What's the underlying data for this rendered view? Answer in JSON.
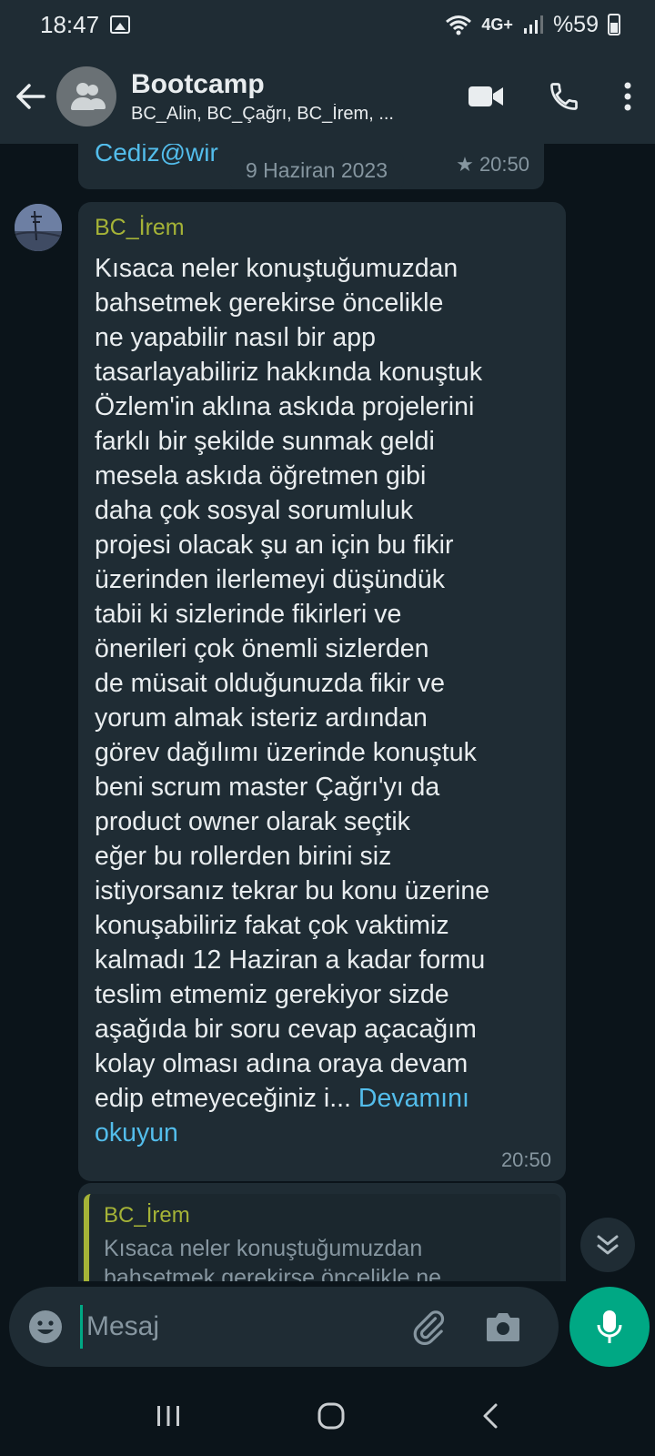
{
  "status_bar": {
    "time": "18:47",
    "network": "4G+",
    "battery": "%59"
  },
  "header": {
    "group_name": "Bootcamp",
    "members": "BC_Alin, BC_Çağrı, BC_İrem, ..."
  },
  "chat": {
    "previous_message": {
      "text_fragment": "Cediz@wir",
      "time": "20:50",
      "starred": true
    },
    "date_divider": "9 Haziran 2023",
    "message": {
      "sender": "BC_İrem",
      "lines": [
        "Kısaca neler konuştuğumuzdan",
        "bahsetmek gerekirse öncelikle",
        "ne yapabilir nasıl bir app",
        "tasarlayabiliriz hakkında konuştuk",
        "Özlem'in aklına askıda projelerini",
        "farklı bir şekilde sunmak geldi",
        "mesela askıda öğretmen gibi",
        "daha çok sosyal sorumluluk",
        "projesi olacak şu an için bu fikir",
        "üzerinden ilerlemeyi düşündük",
        "tabii ki sizlerinde fikirleri ve",
        "önerileri çok önemli sizlerden",
        "de müsait olduğunuzda fikir ve",
        "yorum almak isteriz ardından",
        "görev dağılımı üzerinde konuştuk",
        "beni scrum master Çağrı'yı da",
        "product owner olarak seçtik",
        "eğer bu rollerden birini siz",
        "istiyorsanız tekrar bu konu üzerine",
        "konuşabiliriz fakat çok vaktimiz",
        "kalmadı 12 Haziran a kadar formu",
        "teslim etmemiz gerekiyor sizde",
        "aşağıda bir soru cevap açacağım",
        "kolay olması adına oraya devam"
      ],
      "last_line_text": "edip etmeyeceğiniz i... ",
      "read_more_part1": "Devamını",
      "read_more_part2": "okuyun",
      "time": "20:50"
    },
    "reply_preview": {
      "sender": "BC_İrem",
      "line1": "Kısaca neler konuştuğumuzdan",
      "line2": "bahsetmek gerekirse öncelikle ne"
    }
  },
  "input": {
    "placeholder": "Mesaj"
  },
  "colors": {
    "header_bg": "#1f2c34",
    "chat_bg": "#0b141a",
    "bubble_bg": "#1f2c34",
    "sender_name": "#a5b337",
    "link": "#53bdeb",
    "accent": "#00a884",
    "muted": "#8696a0"
  },
  "icons": {
    "header": [
      "back-arrow-icon",
      "group-avatar-icon",
      "video-call-icon",
      "phone-call-icon",
      "more-vert-icon"
    ],
    "input": [
      "emoji-icon",
      "attach-icon",
      "camera-icon",
      "mic-icon"
    ],
    "nav": [
      "recents-icon",
      "home-icon",
      "back-icon"
    ]
  }
}
